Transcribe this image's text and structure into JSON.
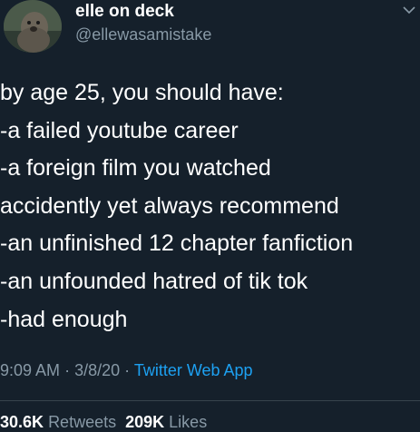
{
  "author": {
    "display_name": "elle on deck",
    "handle": "@ellewasamistake",
    "avatar_icon": "seal-avatar"
  },
  "tweet": {
    "lines": [
      "by age 25, you should have:",
      "-a failed youtube career",
      "-a foreign film you watched",
      "accidently yet always recommend",
      "-an unfinished 12 chapter fanfiction",
      "-an unfounded hatred of tik tok",
      "-had enough"
    ]
  },
  "meta": {
    "time": "9:09 AM",
    "separator": "·",
    "date": "3/8/20",
    "source": "Twitter Web App"
  },
  "stats": {
    "retweets_count": "30.6K",
    "retweets_label": "Retweets",
    "likes_count": "209K",
    "likes_label": "Likes"
  },
  "colors": {
    "background": "#15202b",
    "text": "#ffffff",
    "secondary": "#8899a6",
    "link": "#1da1f2",
    "divider": "#38444d"
  },
  "icons": {
    "menu": "chevron-down-icon"
  }
}
